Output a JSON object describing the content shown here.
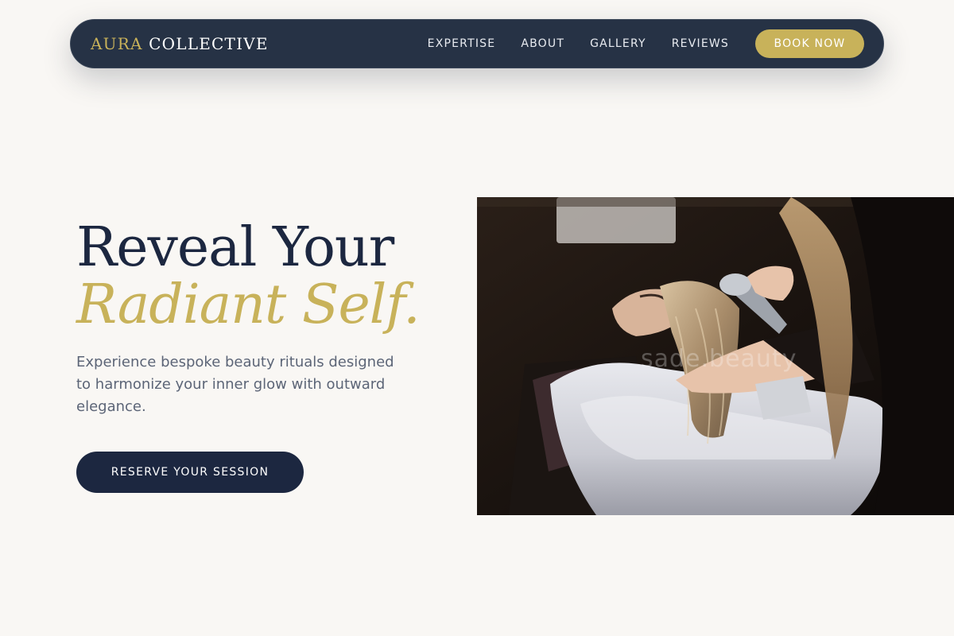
{
  "brand": {
    "name_accent": "AURA",
    "name_main": "COLLECTIVE",
    "accent_color": "#c8b25a",
    "navy_color": "#1c2740"
  },
  "nav": {
    "links": [
      "EXPERTISE",
      "ABOUT",
      "GALLERY",
      "REVIEWS"
    ],
    "book_label": "BOOK NOW"
  },
  "hero": {
    "headline_line1": "Reveal Your",
    "headline_line2": "Radiant Self.",
    "subtext": "Experience bespoke beauty rituals designed to harmonize your inner glow with outward elegance.",
    "cta_label": "RESERVE YOUR SESSION"
  },
  "image": {
    "watermark": "sade.beauty"
  }
}
